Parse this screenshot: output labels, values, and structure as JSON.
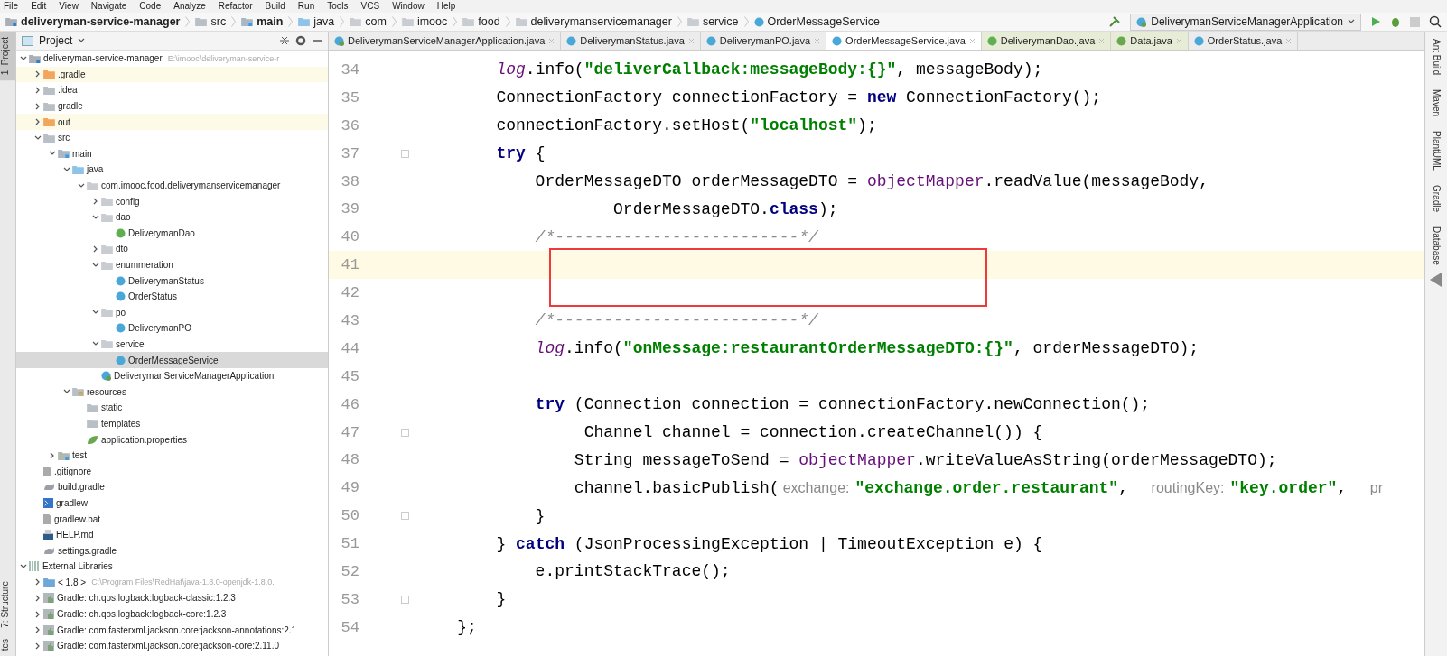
{
  "menu": [
    "File",
    "Edit",
    "View",
    "Navigate",
    "Code",
    "Analyze",
    "Refactor",
    "Build",
    "Run",
    "Tools",
    "VCS",
    "Window",
    "Help"
  ],
  "breadcrumbs": [
    {
      "label": "deliveryman-service-manager",
      "kind": "module"
    },
    {
      "label": "src",
      "kind": "folder"
    },
    {
      "label": "main",
      "kind": "source"
    },
    {
      "label": "java",
      "kind": "java"
    },
    {
      "label": "com",
      "kind": "package"
    },
    {
      "label": "imooc",
      "kind": "package"
    },
    {
      "label": "food",
      "kind": "package"
    },
    {
      "label": "deliverymanservicemanager",
      "kind": "package"
    },
    {
      "label": "service",
      "kind": "package"
    },
    {
      "label": "OrderMessageService",
      "kind": "class"
    }
  ],
  "run_config": "DeliverymanServiceManagerApplication",
  "side_left": [
    {
      "label": "1: Project",
      "selected": true
    },
    {
      "label": "7: Structure",
      "selected": false
    },
    {
      "label": "tes",
      "selected": false
    }
  ],
  "side_right": [
    "Ant Build",
    "Maven",
    "PlantUML",
    "Gradle",
    "Database"
  ],
  "project_panel": {
    "title": "Project",
    "tree": [
      {
        "label": "deliveryman-service-manager",
        "path": "E:\\imooc\\deliveryman-service-r",
        "kind": "module",
        "expanded": true,
        "selected": false,
        "children": [
          {
            "label": ".gradle",
            "kind": "excluded",
            "expanded": false,
            "selected": false
          },
          {
            "label": ".idea",
            "kind": "folder",
            "expanded": false,
            "selected": false
          },
          {
            "label": "gradle",
            "kind": "folder",
            "expanded": false,
            "selected": false
          },
          {
            "label": "out",
            "kind": "excluded",
            "expanded": false,
            "selected": false
          },
          {
            "label": "src",
            "kind": "folder",
            "expanded": true,
            "selected": false,
            "children": [
              {
                "label": "main",
                "kind": "source",
                "expanded": true,
                "selected": false,
                "children": [
                  {
                    "label": "java",
                    "kind": "java",
                    "expanded": true,
                    "selected": false,
                    "children": [
                      {
                        "label": "com.imooc.food.deliverymanservicemanager",
                        "kind": "package",
                        "expanded": true,
                        "selected": false,
                        "children": [
                          {
                            "label": "config",
                            "kind": "package",
                            "expanded": false,
                            "selected": false
                          },
                          {
                            "label": "dao",
                            "kind": "package",
                            "expanded": true,
                            "selected": false,
                            "children": [
                              {
                                "label": "DeliverymanDao",
                                "kind": "interface",
                                "selected": false
                              }
                            ]
                          },
                          {
                            "label": "dto",
                            "kind": "package",
                            "expanded": false,
                            "selected": false
                          },
                          {
                            "label": "enummeration",
                            "kind": "package",
                            "expanded": true,
                            "selected": false,
                            "children": [
                              {
                                "label": "DeliverymanStatus",
                                "kind": "enum",
                                "selected": false
                              },
                              {
                                "label": "OrderStatus",
                                "kind": "enum",
                                "selected": false
                              }
                            ]
                          },
                          {
                            "label": "po",
                            "kind": "package",
                            "expanded": true,
                            "selected": false,
                            "children": [
                              {
                                "label": "DeliverymanPO",
                                "kind": "class",
                                "selected": false
                              }
                            ]
                          },
                          {
                            "label": "service",
                            "kind": "package",
                            "expanded": true,
                            "selected": false,
                            "children": [
                              {
                                "label": "OrderMessageService",
                                "kind": "class",
                                "selected": true
                              }
                            ]
                          },
                          {
                            "label": "DeliverymanServiceManagerApplication",
                            "kind": "spring",
                            "selected": false
                          }
                        ]
                      }
                    ]
                  },
                  {
                    "label": "resources",
                    "kind": "resources",
                    "expanded": true,
                    "selected": false,
                    "children": [
                      {
                        "label": "static",
                        "kind": "folder",
                        "selected": false
                      },
                      {
                        "label": "templates",
                        "kind": "folder",
                        "selected": false
                      },
                      {
                        "label": "application.properties",
                        "kind": "properties",
                        "selected": false
                      }
                    ]
                  }
                ]
              },
              {
                "label": "test",
                "kind": "test",
                "expanded": false,
                "selected": false
              }
            ]
          },
          {
            "label": ".gitignore",
            "kind": "file",
            "selected": false
          },
          {
            "label": "build.gradle",
            "kind": "gradle",
            "selected": false
          },
          {
            "label": "gradlew",
            "kind": "shell",
            "selected": false
          },
          {
            "label": "gradlew.bat",
            "kind": "file",
            "selected": false
          },
          {
            "label": "HELP.md",
            "kind": "md",
            "selected": false
          },
          {
            "label": "settings.gradle",
            "kind": "gradle",
            "selected": false
          }
        ]
      },
      {
        "label": "External Libraries",
        "kind": "libraries",
        "expanded": true,
        "selected": false,
        "children": [
          {
            "label": "< 1.8 >",
            "path": "C:\\Program Files\\RedHat\\java-1.8.0-openjdk-1.8.0.",
            "kind": "jdk",
            "expanded": false,
            "selected": false
          },
          {
            "label": "Gradle: ch.qos.logback:logback-classic:1.2.3",
            "kind": "library",
            "expanded": false,
            "selected": false
          },
          {
            "label": "Gradle: ch.qos.logback:logback-core:1.2.3",
            "kind": "library",
            "expanded": false,
            "selected": false
          },
          {
            "label": "Gradle: com.fasterxml.jackson.core:jackson-annotations:2.1",
            "kind": "library",
            "expanded": false,
            "selected": false
          },
          {
            "label": "Gradle: com.fasterxml.jackson.core:jackson-core:2.11.0",
            "kind": "library",
            "expanded": false,
            "selected": false
          }
        ]
      }
    ]
  },
  "tabs": [
    {
      "label": "DeliverymanServiceManagerApplication.java",
      "kind": "spring",
      "selected": false
    },
    {
      "label": "DeliverymanStatus.java",
      "kind": "enum",
      "selected": false
    },
    {
      "label": "DeliverymanPO.java",
      "kind": "class",
      "selected": false
    },
    {
      "label": "OrderMessageService.java",
      "kind": "class",
      "selected": true
    },
    {
      "label": "DeliverymanDao.java",
      "kind": "interface",
      "selected": false
    },
    {
      "label": "Data.java",
      "kind": "annotation",
      "selected": false
    },
    {
      "label": "OrderStatus.java",
      "kind": "enum",
      "selected": false
    }
  ],
  "code": [
    {
      "number": "34",
      "current": false,
      "fold": false,
      "tokens": [
        {
          "kind": "static",
          "text": "        log"
        },
        {
          "kind": "plain",
          "text": ".info("
        },
        {
          "kind": "string",
          "text": "\"deliverCallback:messageBody:{}\""
        },
        {
          "kind": "plain",
          "text": ", messageBody);"
        }
      ]
    },
    {
      "number": "35",
      "current": false,
      "fold": false,
      "tokens": [
        {
          "kind": "plain",
          "text": "        ConnectionFactory connectionFactory = "
        },
        {
          "kind": "keyword",
          "text": "new"
        },
        {
          "kind": "plain",
          "text": " ConnectionFactory();"
        }
      ]
    },
    {
      "number": "36",
      "current": false,
      "fold": false,
      "tokens": [
        {
          "kind": "plain",
          "text": "        connectionFactory.setHost("
        },
        {
          "kind": "string",
          "text": "\"localhost\""
        },
        {
          "kind": "plain",
          "text": ");"
        }
      ]
    },
    {
      "number": "37",
      "current": false,
      "fold": true,
      "tokens": [
        {
          "kind": "keyword",
          "text": "        try"
        },
        {
          "kind": "plain",
          "text": " {"
        }
      ]
    },
    {
      "number": "38",
      "current": false,
      "fold": false,
      "tokens": [
        {
          "kind": "plain",
          "text": "            OrderMessageDTO orderMessageDTO = "
        },
        {
          "kind": "field",
          "text": "objectMapper"
        },
        {
          "kind": "plain",
          "text": ".readValue(messageBody,"
        }
      ]
    },
    {
      "number": "39",
      "current": false,
      "fold": false,
      "tokens": [
        {
          "kind": "plain",
          "text": "                    OrderMessageDTO."
        },
        {
          "kind": "keyword",
          "text": "class"
        },
        {
          "kind": "plain",
          "text": ");"
        }
      ]
    },
    {
      "number": "40",
      "current": false,
      "fold": false,
      "tokens": [
        {
          "kind": "comment",
          "text": "            /*-------------------------*/"
        }
      ]
    },
    {
      "number": "41",
      "current": true,
      "fold": false
    },
    {
      "number": "42",
      "current": false,
      "fold": false
    },
    {
      "number": "43",
      "current": false,
      "fold": false,
      "tokens": [
        {
          "kind": "comment",
          "text": "            /*-------------------------*/"
        }
      ]
    },
    {
      "number": "44",
      "current": false,
      "fold": false,
      "tokens": [
        {
          "kind": "static",
          "text": "            log"
        },
        {
          "kind": "plain",
          "text": ".info("
        },
        {
          "kind": "string",
          "text": "\"onMessage:restaurantOrderMessageDTO:{}\""
        },
        {
          "kind": "plain",
          "text": ", orderMessageDTO);"
        }
      ]
    },
    {
      "number": "45",
      "current": false,
      "fold": false
    },
    {
      "number": "46",
      "current": false,
      "fold": false,
      "tokens": [
        {
          "kind": "keyword",
          "text": "            try"
        },
        {
          "kind": "plain",
          "text": " (Connection connection = connectionFactory.newConnection();"
        }
      ]
    },
    {
      "number": "47",
      "current": false,
      "fold": true,
      "tokens": [
        {
          "kind": "plain",
          "text": "                 Channel channel = connection.createChannel()) {"
        }
      ]
    },
    {
      "number": "48",
      "current": false,
      "fold": false,
      "tokens": [
        {
          "kind": "plain",
          "text": "                String messageToSend = "
        },
        {
          "kind": "field",
          "text": "objectMapper"
        },
        {
          "kind": "plain",
          "text": ".writeValueAsString(orderMessageDTO);"
        }
      ]
    },
    {
      "number": "49",
      "current": false,
      "fold": false,
      "tokens": [
        {
          "kind": "plain",
          "text": "                channel.basicPublish("
        },
        {
          "kind": "hint",
          "text": "exchange:"
        },
        {
          "kind": "string",
          "text": "\"exchange.order.restaurant\""
        },
        {
          "kind": "plain",
          "text": ",  "
        },
        {
          "kind": "hint",
          "text": "routingKey:"
        },
        {
          "kind": "string",
          "text": "\"key.order\""
        },
        {
          "kind": "plain",
          "text": ",  "
        },
        {
          "kind": "hint",
          "text": "pr"
        }
      ]
    },
    {
      "number": "50",
      "current": false,
      "fold": true,
      "tokens": [
        {
          "kind": "plain",
          "text": "            }"
        }
      ]
    },
    {
      "number": "51",
      "current": false,
      "fold": false,
      "tokens": [
        {
          "kind": "plain",
          "text": "        } "
        },
        {
          "kind": "keyword",
          "text": "catch"
        },
        {
          "kind": "plain",
          "text": " (JsonProcessingException | TimeoutException e) {"
        }
      ]
    },
    {
      "number": "52",
      "current": false,
      "fold": false,
      "tokens": [
        {
          "kind": "plain",
          "text": "            e.printStackTrace();"
        }
      ]
    },
    {
      "number": "53",
      "current": false,
      "fold": true,
      "tokens": [
        {
          "kind": "plain",
          "text": "        }"
        }
      ]
    },
    {
      "number": "54",
      "current": false,
      "fold": false,
      "tokens": [
        {
          "kind": "plain",
          "text": "    };"
        }
      ]
    }
  ]
}
